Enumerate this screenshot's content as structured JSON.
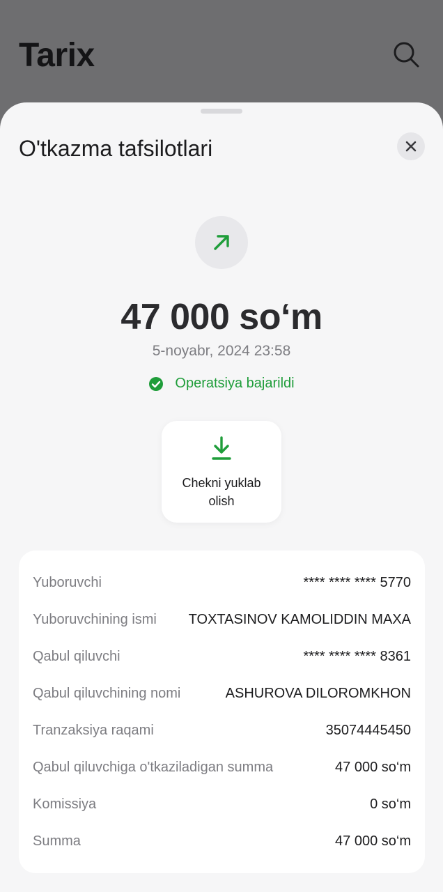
{
  "backdrop": {
    "title": "Tarix",
    "search_icon": "search-icon"
  },
  "sheet": {
    "title": "O'tkazma tafsilotlari",
    "close_icon": "close-icon",
    "direction_icon": "arrow-up-right-icon",
    "amount": "47 000 so‘m",
    "datetime": "5-noyabr, 2024 23:58",
    "status": {
      "text": "Operatsiya bajarildi",
      "icon": "check-circle-icon",
      "color": "#1f9d3a"
    },
    "download": {
      "label": "Chekni yuklab\nolish",
      "icon": "download-icon"
    }
  },
  "details": [
    {
      "label": "Yuboruvchi",
      "value": "**** **** **** 5770"
    },
    {
      "label": "Yuboruvchining ismi",
      "value": "TOXTASINOV KAMOLIDDIN MAXA"
    },
    {
      "label": "Qabul qiluvchi",
      "value": "**** **** **** 8361"
    },
    {
      "label": "Qabul qiluvchining nomi",
      "value": "ASHUROVA DILOROMKHON"
    },
    {
      "label": "Tranzaksiya raqami",
      "value": "35074445450"
    },
    {
      "label": "Qabul qiluvchiga o'tkaziladigan summa",
      "value": "47 000 so‘m"
    },
    {
      "label": "Komissiya",
      "value": "0 so‘m"
    },
    {
      "label": "Summa",
      "value": "47 000 so‘m"
    }
  ],
  "colors": {
    "accent": "#1f9d3a",
    "overlay": "#6e6e70",
    "sheet_bg": "#f6f6f7"
  }
}
